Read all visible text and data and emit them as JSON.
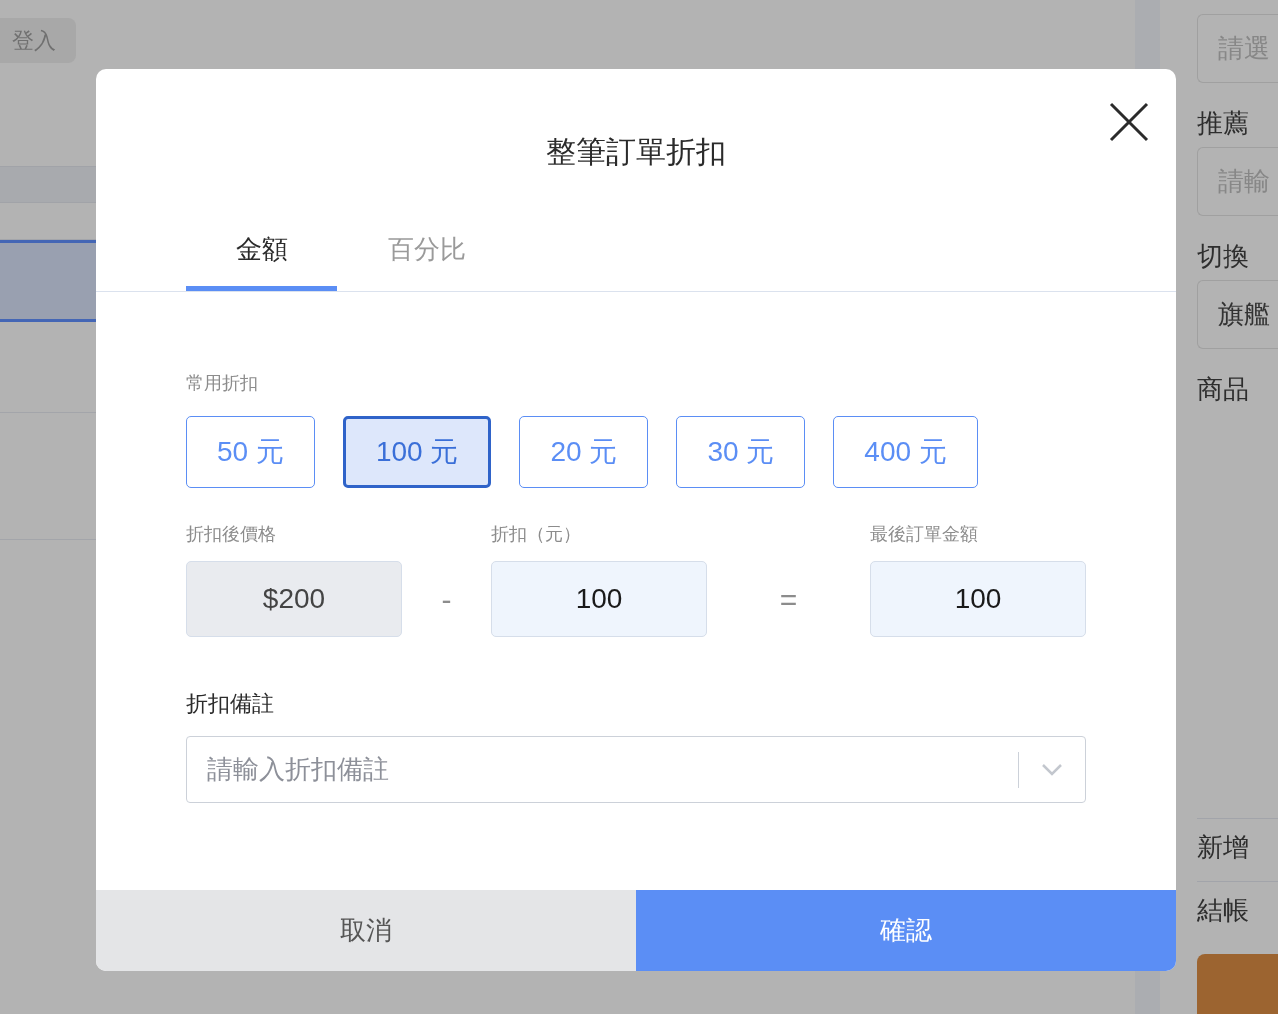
{
  "background": {
    "login_button": "登入",
    "list_rows": [
      {
        "selected": false
      },
      {
        "selected": true
      },
      {
        "selected": false
      },
      {
        "selected": false
      }
    ],
    "side_panel": [
      {
        "kind": "field",
        "placeholder": "請選"
      },
      {
        "kind": "label",
        "text": "推薦"
      },
      {
        "kind": "field",
        "placeholder": "請輸"
      },
      {
        "kind": "label",
        "text": "切換"
      },
      {
        "kind": "field",
        "value": "旗艦"
      },
      {
        "kind": "label",
        "text": "商品"
      },
      {
        "kind": "footer",
        "text": "新增"
      },
      {
        "kind": "footer",
        "text": "結帳"
      },
      {
        "kind": "action"
      }
    ]
  },
  "modal": {
    "title": "整筆訂單折扣",
    "tabs": [
      {
        "label": "金額",
        "selected": true
      },
      {
        "label": "百分比",
        "selected": false
      }
    ],
    "presets": {
      "label": "常用折扣",
      "options": [
        {
          "label": "50 元",
          "selected": false
        },
        {
          "label": "100 元",
          "selected": true
        },
        {
          "label": "20 元",
          "selected": false
        },
        {
          "label": "30 元",
          "selected": false
        },
        {
          "label": "400 元",
          "selected": false
        }
      ]
    },
    "calculation": [
      {
        "kind": "field",
        "label": "折扣後價格",
        "value": "$200",
        "disabled": true
      },
      {
        "kind": "operator",
        "text": "-"
      },
      {
        "kind": "field",
        "label": "折扣（元）",
        "value": "100",
        "disabled": false
      },
      {
        "kind": "operator",
        "text": "="
      },
      {
        "kind": "field",
        "label": "最後訂單金額",
        "value": "100",
        "disabled": false
      }
    ],
    "note": {
      "label": "折扣備註",
      "placeholder": "請輸入折扣備註"
    },
    "buttons": [
      {
        "kind": "cancel",
        "label": "取消"
      },
      {
        "kind": "confirm",
        "label": "確認"
      }
    ]
  }
}
